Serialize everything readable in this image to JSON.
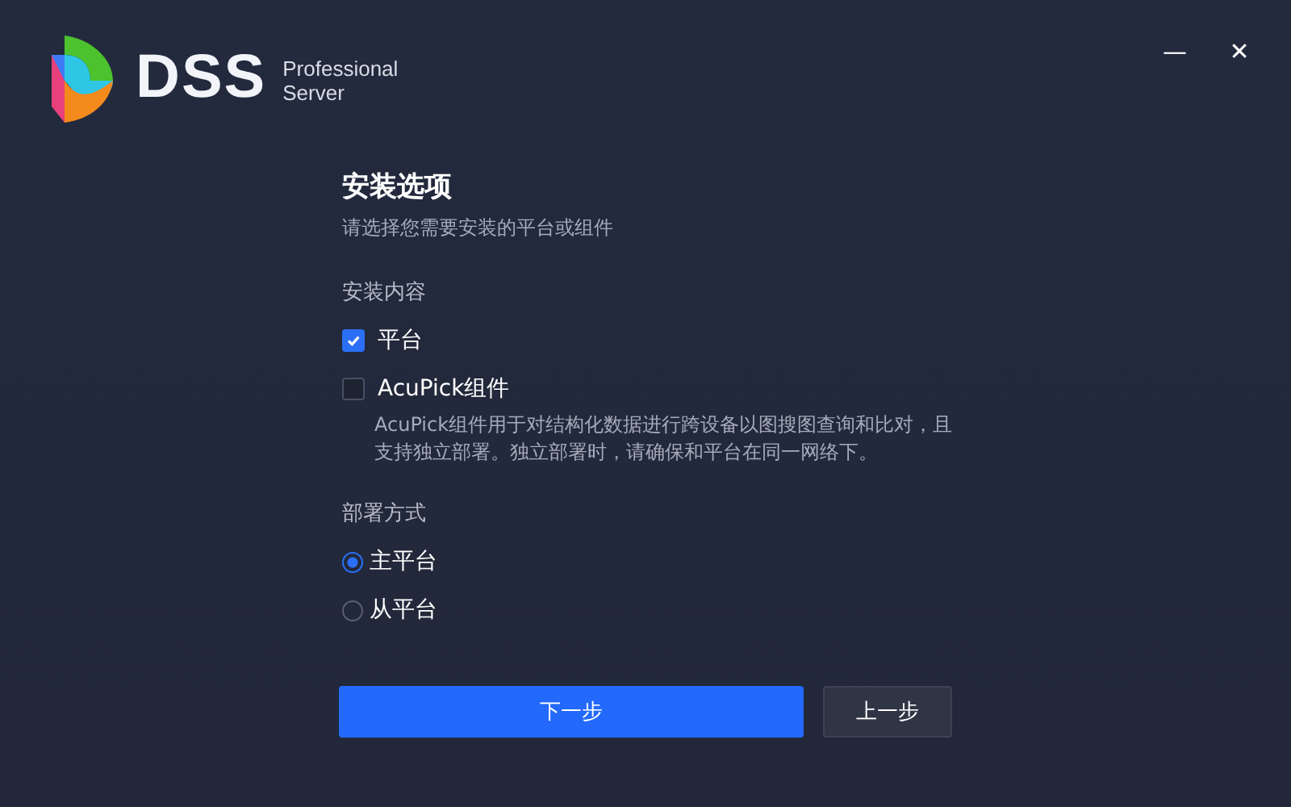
{
  "header": {
    "brand": "DSS",
    "brand_line_1": "Professional",
    "brand_line_2": "Server"
  },
  "window_controls": {
    "minimize": "—",
    "close": "✕"
  },
  "title": "安装选项",
  "subtitle": "请选择您需要安装的平台或组件",
  "install_section": {
    "label": "安装内容",
    "options": [
      {
        "label": "平台",
        "checked": true
      },
      {
        "label": "AcuPick组件",
        "checked": false,
        "description": "AcuPick组件用于对结构化数据进行跨设备以图搜图查询和比对，且支持独立部署。独立部署时，请确保和平台在同一网络下。"
      }
    ]
  },
  "deploy_section": {
    "label": "部署方式",
    "options": [
      {
        "label": "主平台",
        "selected": true
      },
      {
        "label": "从平台",
        "selected": false
      }
    ]
  },
  "buttons": [
    {
      "label": "下一步",
      "kind": "primary"
    },
    {
      "label": "上一步",
      "kind": "secondary"
    }
  ]
}
